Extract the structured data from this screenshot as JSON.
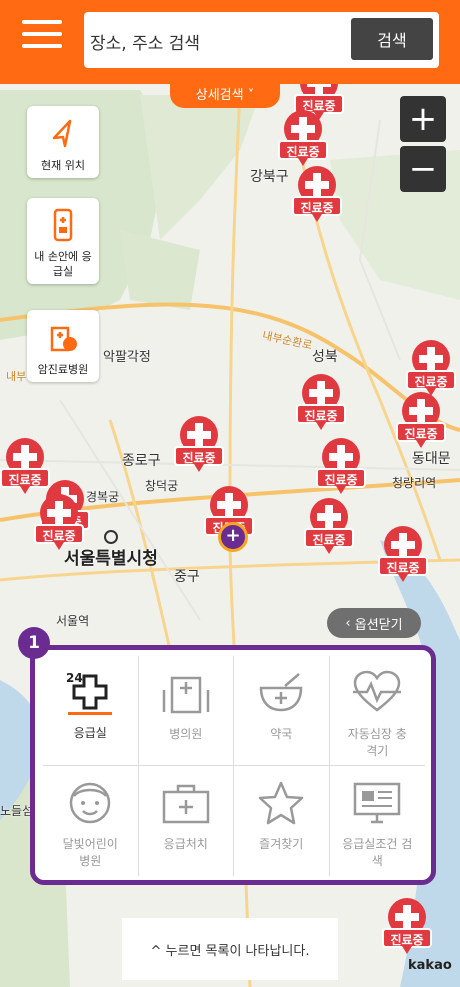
{
  "search": {
    "placeholder": "장소, 주소 검색",
    "button_label": "검색"
  },
  "detail_search_tab": "상세검색 ˅",
  "zoom": {
    "plus": "+",
    "minus": "−"
  },
  "side_buttons": [
    {
      "label": "현재 위치",
      "icon": "location-arrow-icon"
    },
    {
      "label": "내 손안에 응급실",
      "icon": "phone-hospital-icon"
    },
    {
      "label": "암진료병원",
      "icon": "cancer-hospital-icon"
    }
  ],
  "map_labels": {
    "gangbuk": "강북구",
    "seongbuk": "성북",
    "naebu": "내부순환로",
    "naebu2": "내부",
    "akpal": "악팔각정",
    "jongno": "종로구",
    "changdeok": "창덕궁",
    "gyeongbok": "경복궁",
    "city_hall": "서울특별시청",
    "jung": "중구",
    "seoul_station": "서울역",
    "dongdaemun": "동대문",
    "cheongnyangri": "청량리역",
    "nodeul": "노들섬"
  },
  "pin_label": "진료중",
  "option_close": "옵션닫기",
  "callout_number": "1",
  "categories": [
    {
      "label": "응급실",
      "icon": "emergency-24-icon",
      "selected": true,
      "icon_text": "24"
    },
    {
      "label": "병의원",
      "icon": "hospital-building-icon",
      "selected": false
    },
    {
      "label": "약국",
      "icon": "pharmacy-bowl-icon",
      "selected": false
    },
    {
      "label": "자동심장 충격기",
      "icon": "heart-defibrillator-icon",
      "selected": false
    },
    {
      "label": "달빛어린이 병원",
      "icon": "child-face-icon",
      "selected": false
    },
    {
      "label": "응급처치",
      "icon": "first-aid-kit-icon",
      "selected": false
    },
    {
      "label": "즐겨찾기",
      "icon": "star-icon",
      "selected": false
    },
    {
      "label": "응급실조건 검색",
      "icon": "monitor-search-icon",
      "selected": false
    }
  ],
  "bottom_hint": "^ 누르면 목록이 나타납니다.",
  "brand": "kakao"
}
